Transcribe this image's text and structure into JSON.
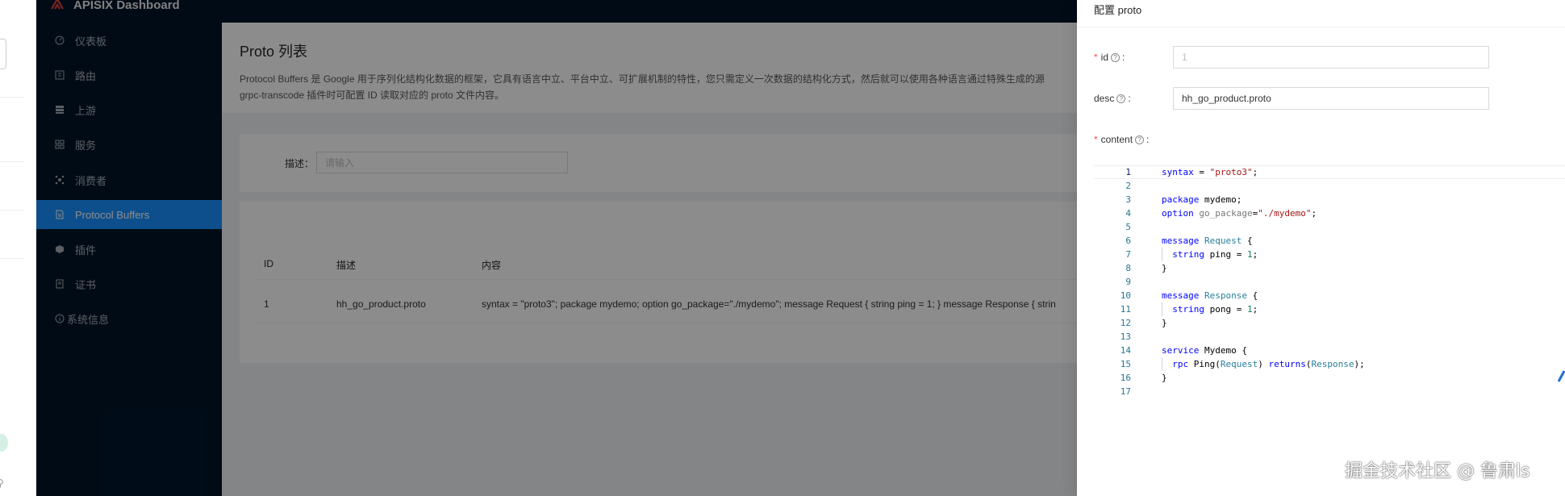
{
  "app": {
    "title": "APISIX Dashboard"
  },
  "sidebar": {
    "items": [
      {
        "label": "仪表板",
        "icon": "dashboard-icon"
      },
      {
        "label": "路由",
        "icon": "route-icon"
      },
      {
        "label": "上游",
        "icon": "upstream-icon"
      },
      {
        "label": "服务",
        "icon": "service-icon"
      },
      {
        "label": "消费者",
        "icon": "consumer-icon"
      },
      {
        "label": "Protocol Buffers",
        "icon": "file-icon",
        "active": true
      },
      {
        "label": "插件",
        "icon": "plugin-icon"
      },
      {
        "label": "证书",
        "icon": "certificate-icon"
      },
      {
        "label": "系统信息",
        "icon": "info-icon"
      }
    ]
  },
  "page": {
    "title": "Proto 列表",
    "description_line1": "Protocol Buffers 是 Google 用于序列化结构化数据的框架，它具有语言中立、平台中立、可扩展机制的特性，您只需定义一次数据的结构化方式，然后就可以使用各种语言通过特殊生成的源",
    "description_line2": "grpc-transcode 插件时可配置 ID 读取对应的 proto 文件内容。"
  },
  "search": {
    "label": "描述：",
    "placeholder": "请输入"
  },
  "table": {
    "columns": [
      "ID",
      "描述",
      "内容"
    ],
    "rows": [
      {
        "id": "1",
        "desc": "hh_go_product.proto",
        "content": "syntax = \"proto3\"; package mydemo; option go_package=\"./mydemo\"; message Request { string ping = 1; } message Response { strin"
      }
    ]
  },
  "drawer": {
    "title": "配置 proto",
    "fields": {
      "id": {
        "label": "id",
        "value": "1",
        "required": true
      },
      "desc": {
        "label": "desc",
        "value": "hh_go_product.proto",
        "required": false
      },
      "content": {
        "label": "content",
        "required": true
      }
    },
    "code_lines": [
      "syntax = \"proto3\";",
      "",
      "package mydemo;",
      "option go_package=\"./mydemo\";",
      "",
      "message Request {",
      "  string ping = 1;",
      "}",
      "",
      "message Response {",
      "  string pong = 1;",
      "}",
      "",
      "service Mydemo {",
      "  rpc Ping(Request) returns(Response);",
      "}",
      ""
    ]
  },
  "watermark": "掘金技术社区 @ 鲁肃ls"
}
